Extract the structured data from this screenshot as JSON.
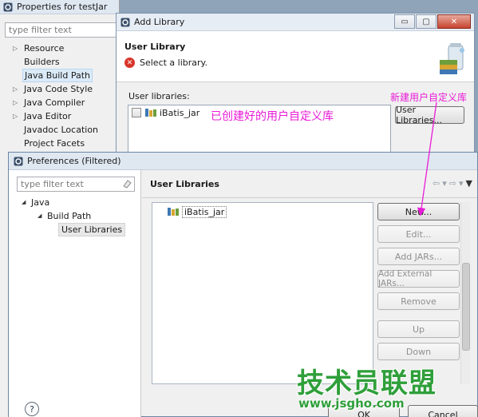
{
  "properties_window": {
    "title": "Properties for testJar",
    "filter_placeholder": "type filter text",
    "tree": [
      {
        "label": "Resource",
        "expandable": true
      },
      {
        "label": "Builders",
        "expandable": false
      },
      {
        "label": "Java Build Path",
        "expandable": false,
        "selected": true
      },
      {
        "label": "Java Code Style",
        "expandable": true
      },
      {
        "label": "Java Compiler",
        "expandable": true
      },
      {
        "label": "Java Editor",
        "expandable": true
      },
      {
        "label": "Javadoc Location",
        "expandable": false
      },
      {
        "label": "Project Facets",
        "expandable": false
      }
    ]
  },
  "add_library": {
    "title": "Add Library",
    "header_title": "User Library",
    "header_message": "Select a library.",
    "user_libraries_label": "User libraries:",
    "libraries": [
      {
        "name": "iBatis_jar",
        "checked": false
      }
    ],
    "user_libraries_button": "User Libraries...",
    "window_buttons": {
      "minimize": "▭",
      "maximize": "▢",
      "close": "✕"
    }
  },
  "annotations": {
    "created_library": "已创建好的用户自定义库",
    "new_library": "新建用户自定义库"
  },
  "preferences": {
    "title": "Preferences (Filtered)",
    "filter_placeholder": "type filter text",
    "tree": {
      "java": "Java",
      "build_path": "Build Path",
      "user_libraries": "User Libraries"
    },
    "page_title": "User Libraries",
    "libraries": [
      {
        "name": "iBatis_jar"
      }
    ],
    "buttons": [
      {
        "label": "New...",
        "enabled": true
      },
      {
        "label": "Edit...",
        "enabled": false
      },
      {
        "label": "Add JARs...",
        "enabled": false
      },
      {
        "label": "Add External JARs...",
        "enabled": false
      },
      {
        "label": "Remove",
        "enabled": false
      },
      {
        "label": "Up",
        "enabled": false
      },
      {
        "label": "Down",
        "enabled": false
      }
    ],
    "help_label": "?",
    "ok_label": "OK",
    "cancel_label": "Cancel"
  },
  "watermark": {
    "brand": "技术员联盟",
    "url": "www.jsgho.com"
  },
  "colors": {
    "annotation": "#e91bd6",
    "watermark": "#2f9f3a",
    "error": "#d8352a"
  }
}
